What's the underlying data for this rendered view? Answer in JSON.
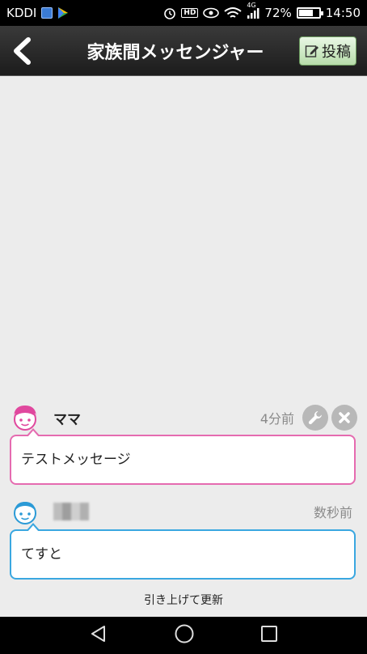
{
  "status_bar": {
    "carrier": "KDDI",
    "network": "4G",
    "battery": "72%",
    "battery_level": 0.72,
    "time": "14:50",
    "hd_label": "HD"
  },
  "header": {
    "title": "家族間メッセンジャー",
    "post_label": "投稿"
  },
  "messages": [
    {
      "sender": "ママ",
      "time": "4分前",
      "text": "テストメッセージ",
      "color": "#e56bb0",
      "avatar": "pink-face-icon"
    },
    {
      "sender": "",
      "time": "数秒前",
      "text": "てすと",
      "color": "#3aa7e0",
      "avatar": "blue-face-icon"
    }
  ],
  "pull_to_refresh": "引き上げて更新",
  "icons": {
    "back": "chevron-left-icon",
    "edit": "edit-icon",
    "wrench": "wrench-icon",
    "close": "close-icon",
    "nav_back": "triangle-back-icon",
    "nav_home": "circle-home-icon",
    "nav_recent": "square-recent-icon"
  }
}
